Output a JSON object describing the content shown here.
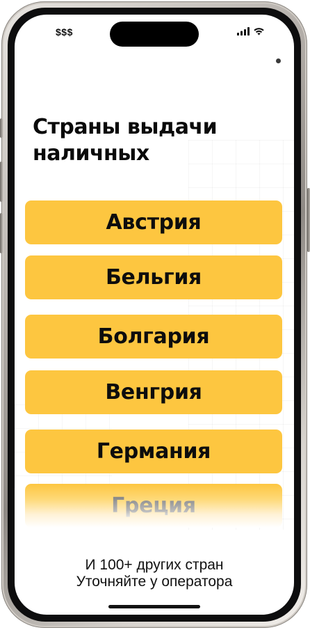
{
  "status_bar": {
    "carrier": "$$$"
  },
  "page": {
    "title_line1": "Страны выдачи",
    "title_line2": "наличных"
  },
  "countries": [
    {
      "label": "Австрия"
    },
    {
      "label": "Бельгия"
    },
    {
      "label": "Болгария"
    },
    {
      "label": "Венгрия"
    },
    {
      "label": "Германия"
    },
    {
      "label": "Греция"
    }
  ],
  "footer": {
    "line1": "И 100+ других стран",
    "line2": "Уточняйте у оператора"
  },
  "colors": {
    "button_bg": "#fdc640",
    "text": "#0d0d0d",
    "frame": "#bdb8b3"
  },
  "icons": [
    "signal-icon",
    "wifi-icon",
    "menu-dot-icon"
  ]
}
